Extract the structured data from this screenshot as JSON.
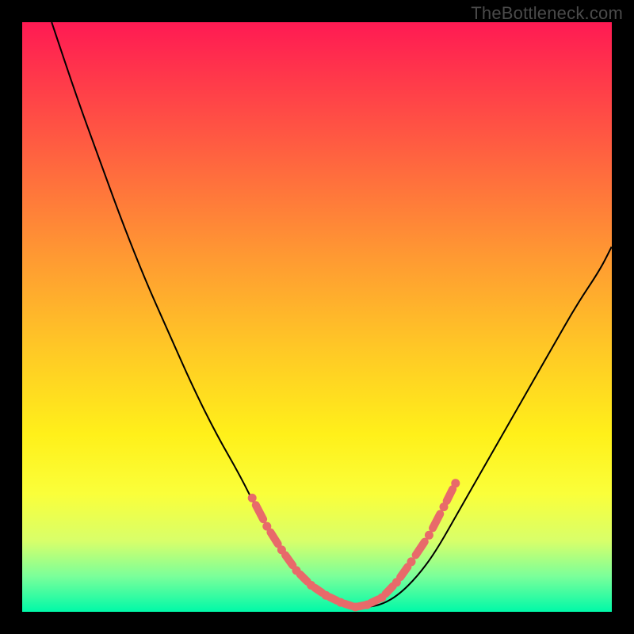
{
  "watermark": "TheBottleneck.com",
  "chart_data": {
    "type": "line",
    "title": "",
    "xlabel": "",
    "ylabel": "",
    "xlim": [
      0,
      1
    ],
    "ylim": [
      0,
      1
    ],
    "grid": false,
    "legend": false,
    "series": [
      {
        "name": "curve",
        "x": [
          0.05,
          0.09,
          0.13,
          0.17,
          0.21,
          0.25,
          0.29,
          0.33,
          0.37,
          0.4,
          0.43,
          0.46,
          0.49,
          0.52,
          0.55,
          0.58,
          0.61,
          0.64,
          0.67,
          0.7,
          0.74,
          0.78,
          0.82,
          0.86,
          0.9,
          0.94,
          0.98,
          1.0
        ],
        "y": [
          1.0,
          0.88,
          0.77,
          0.66,
          0.56,
          0.47,
          0.38,
          0.3,
          0.23,
          0.17,
          0.12,
          0.075,
          0.045,
          0.025,
          0.012,
          0.007,
          0.012,
          0.03,
          0.06,
          0.1,
          0.17,
          0.24,
          0.31,
          0.38,
          0.45,
          0.52,
          0.58,
          0.62
        ]
      }
    ],
    "markers": {
      "name": "highlight-band",
      "color": "#e86a6a",
      "points_norm": [
        [
          0.39,
          0.193
        ],
        [
          0.415,
          0.145
        ],
        [
          0.44,
          0.105
        ],
        [
          0.465,
          0.07
        ],
        [
          0.49,
          0.045
        ],
        [
          0.515,
          0.028
        ],
        [
          0.54,
          0.016
        ],
        [
          0.565,
          0.008
        ],
        [
          0.585,
          0.012
        ],
        [
          0.61,
          0.024
        ],
        [
          0.635,
          0.05
        ],
        [
          0.66,
          0.085
        ],
        [
          0.69,
          0.13
        ],
        [
          0.715,
          0.178
        ],
        [
          0.735,
          0.218
        ]
      ]
    }
  }
}
